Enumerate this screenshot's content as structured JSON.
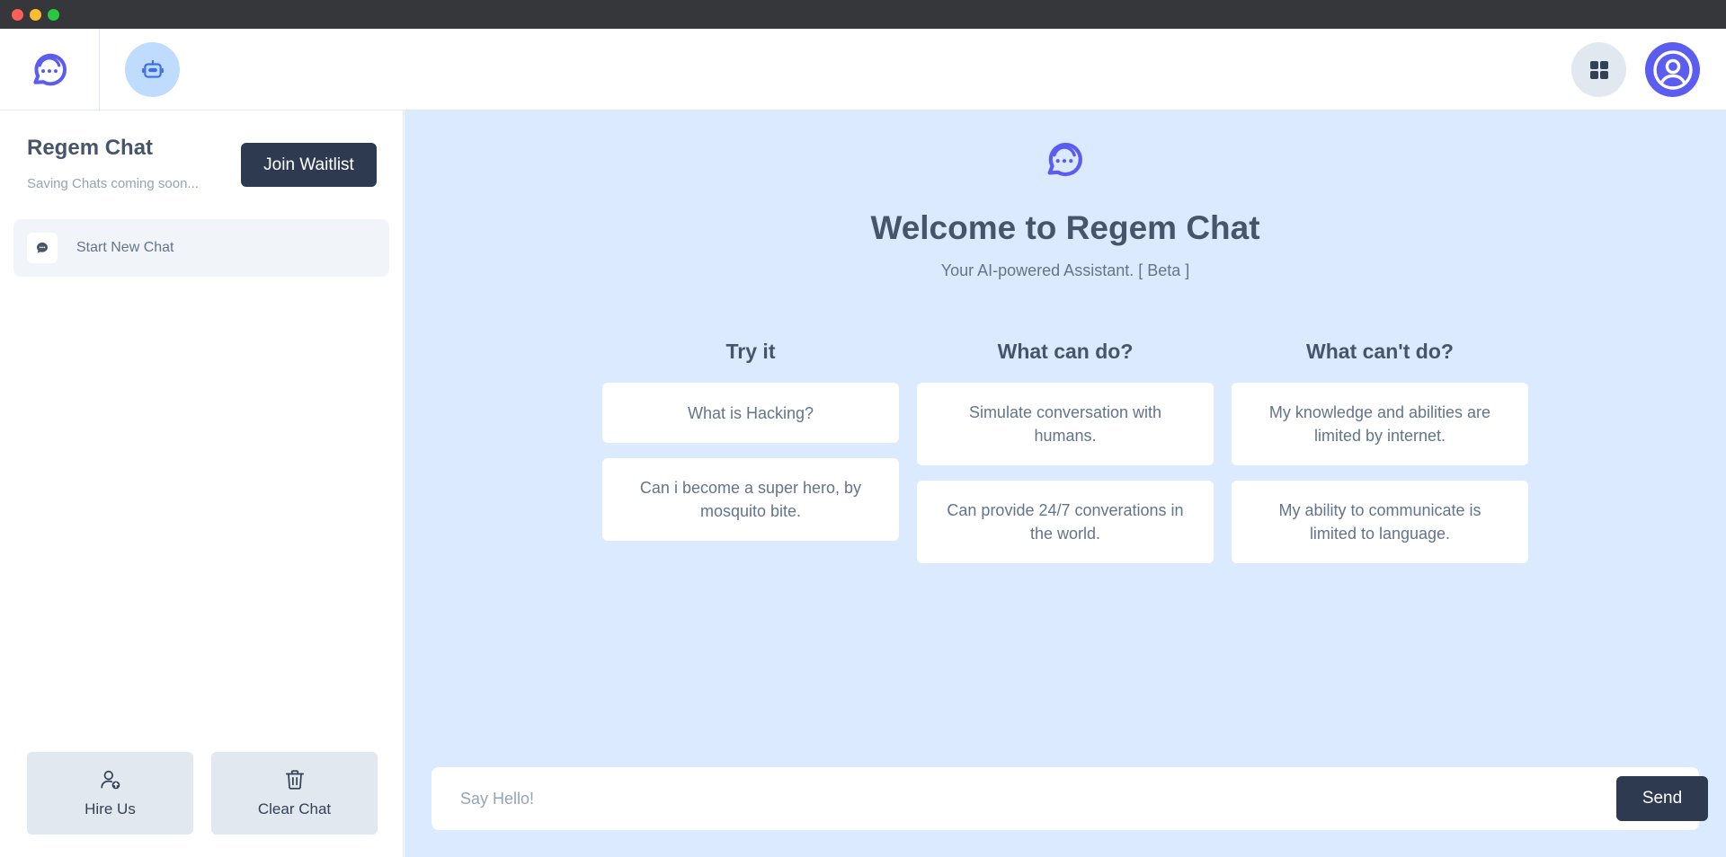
{
  "colors": {
    "accent": "#5b5cf0",
    "dark_button": "#2e3a4f",
    "main_bg": "#dbeafe",
    "bot_badge": "#bfdbfe"
  },
  "header": {
    "logo_icon": "chat-bubble-logo-icon",
    "bot_icon": "robot-icon",
    "apps_icon": "grid-icon",
    "profile_icon": "user-circle-icon"
  },
  "sidebar": {
    "title": "Regem Chat",
    "subtitle": "Saving Chats coming soon...",
    "join_label": "Join Waitlist",
    "new_chat_label": "Start New Chat",
    "hire_label": "Hire Us",
    "clear_label": "Clear Chat"
  },
  "main": {
    "title": "Welcome to Regem Chat",
    "tagline": "Your AI-powered Assistant. [ Beta ]",
    "columns": [
      {
        "heading": "Try it",
        "cards": [
          "What is Hacking?",
          "Can i become a super hero, by mosquito bite."
        ]
      },
      {
        "heading": "What can do?",
        "cards": [
          "Simulate conversation with humans.",
          "Can provide 24/7 converations in the world."
        ]
      },
      {
        "heading": "What can't do?",
        "cards": [
          "My knowledge and abilities are limited by internet.",
          "My ability to communicate is limited to language."
        ]
      }
    ]
  },
  "composer": {
    "placeholder": "Say Hello!",
    "value": "",
    "send_label": "Send"
  }
}
